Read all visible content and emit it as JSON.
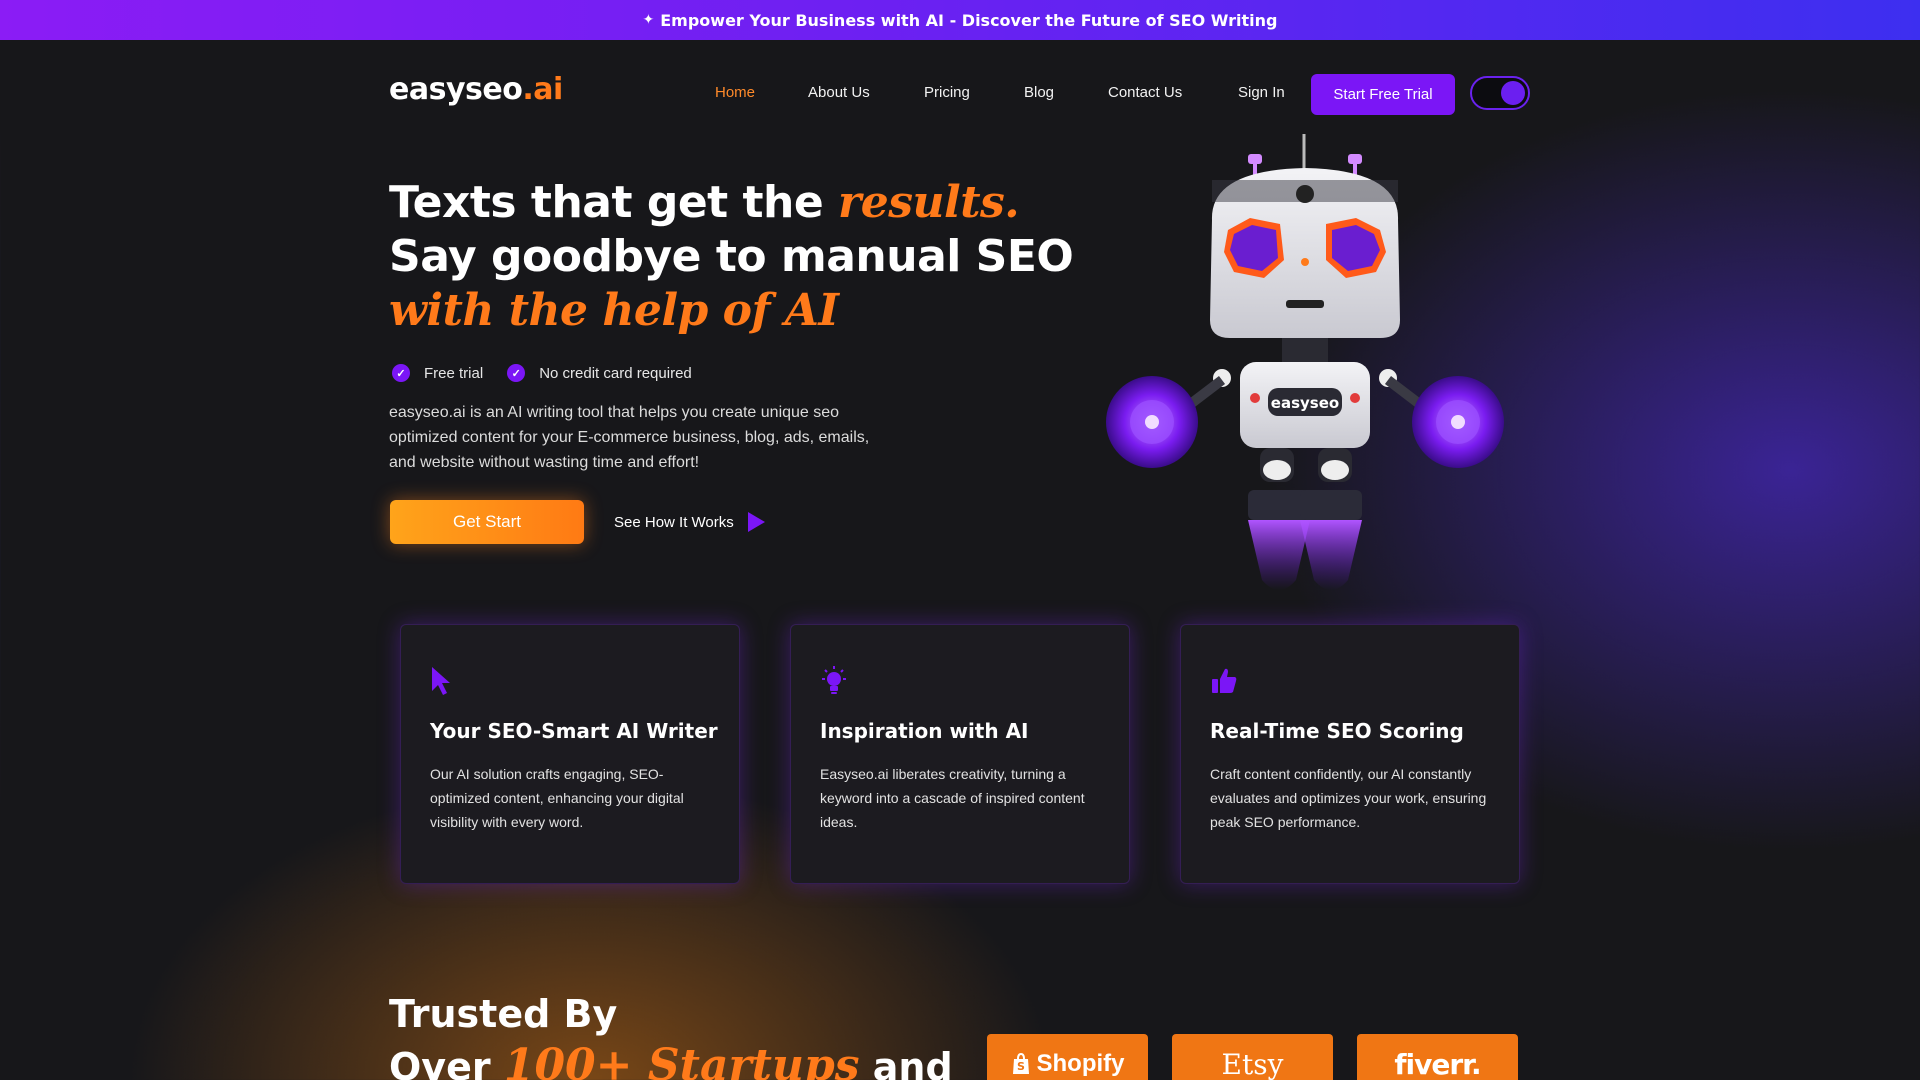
{
  "banner": {
    "icon": "sparkle-icon",
    "text": "Empower Your Business with AI - Discover the Future of SEO Writing"
  },
  "header": {
    "logo_main": "easyseo",
    "logo_accent": ".ai",
    "nav": [
      "Home",
      "About Us",
      "Pricing",
      "Blog",
      "Contact Us",
      "Sign In"
    ],
    "active_nav": "Home",
    "cta": "Start Free Trial",
    "theme_toggle": "dark"
  },
  "hero": {
    "title_part1": "Texts that get the ",
    "title_hl1": "results.",
    "title_part2": " Say goodbye to manual SEO ",
    "title_hl2": "with the help of AI",
    "checks": [
      "Free trial",
      "No credit card required"
    ],
    "description": "easyseo.ai is an AI writing tool that helps you create unique seo optimized content for your E-commerce business, blog, ads, emails, and website without wasting time and effort!",
    "primary_button": "Get Start",
    "secondary_button": "See How It Works",
    "robot_badge": "easyseo"
  },
  "features": [
    {
      "icon": "cursor-icon",
      "title": "Your SEO-Smart AI Writer",
      "text": "Our AI solution crafts engaging, SEO-optimized content, enhancing your digital visibility with every word."
    },
    {
      "icon": "lightbulb-icon",
      "title": "Inspiration with AI",
      "text": "Easyseo.ai liberates creativity, turning a keyword into a cascade of inspired content ideas."
    },
    {
      "icon": "thumbs-up-icon",
      "title": "Real-Time SEO Scoring",
      "text": "Craft content confidently, our AI constantly evaluates and optimizes your work, ensuring peak SEO performance."
    }
  ],
  "trusted": {
    "line1": "Trusted By",
    "line2_pre": "Over ",
    "line2_hl": "100+ Startups",
    "line2_post": " and",
    "brands": [
      "Shopify",
      "Etsy",
      "fiverr."
    ]
  },
  "colors": {
    "accent_orange": "#ff7a1a",
    "accent_purple": "#7b16f6",
    "background": "#17171a"
  }
}
